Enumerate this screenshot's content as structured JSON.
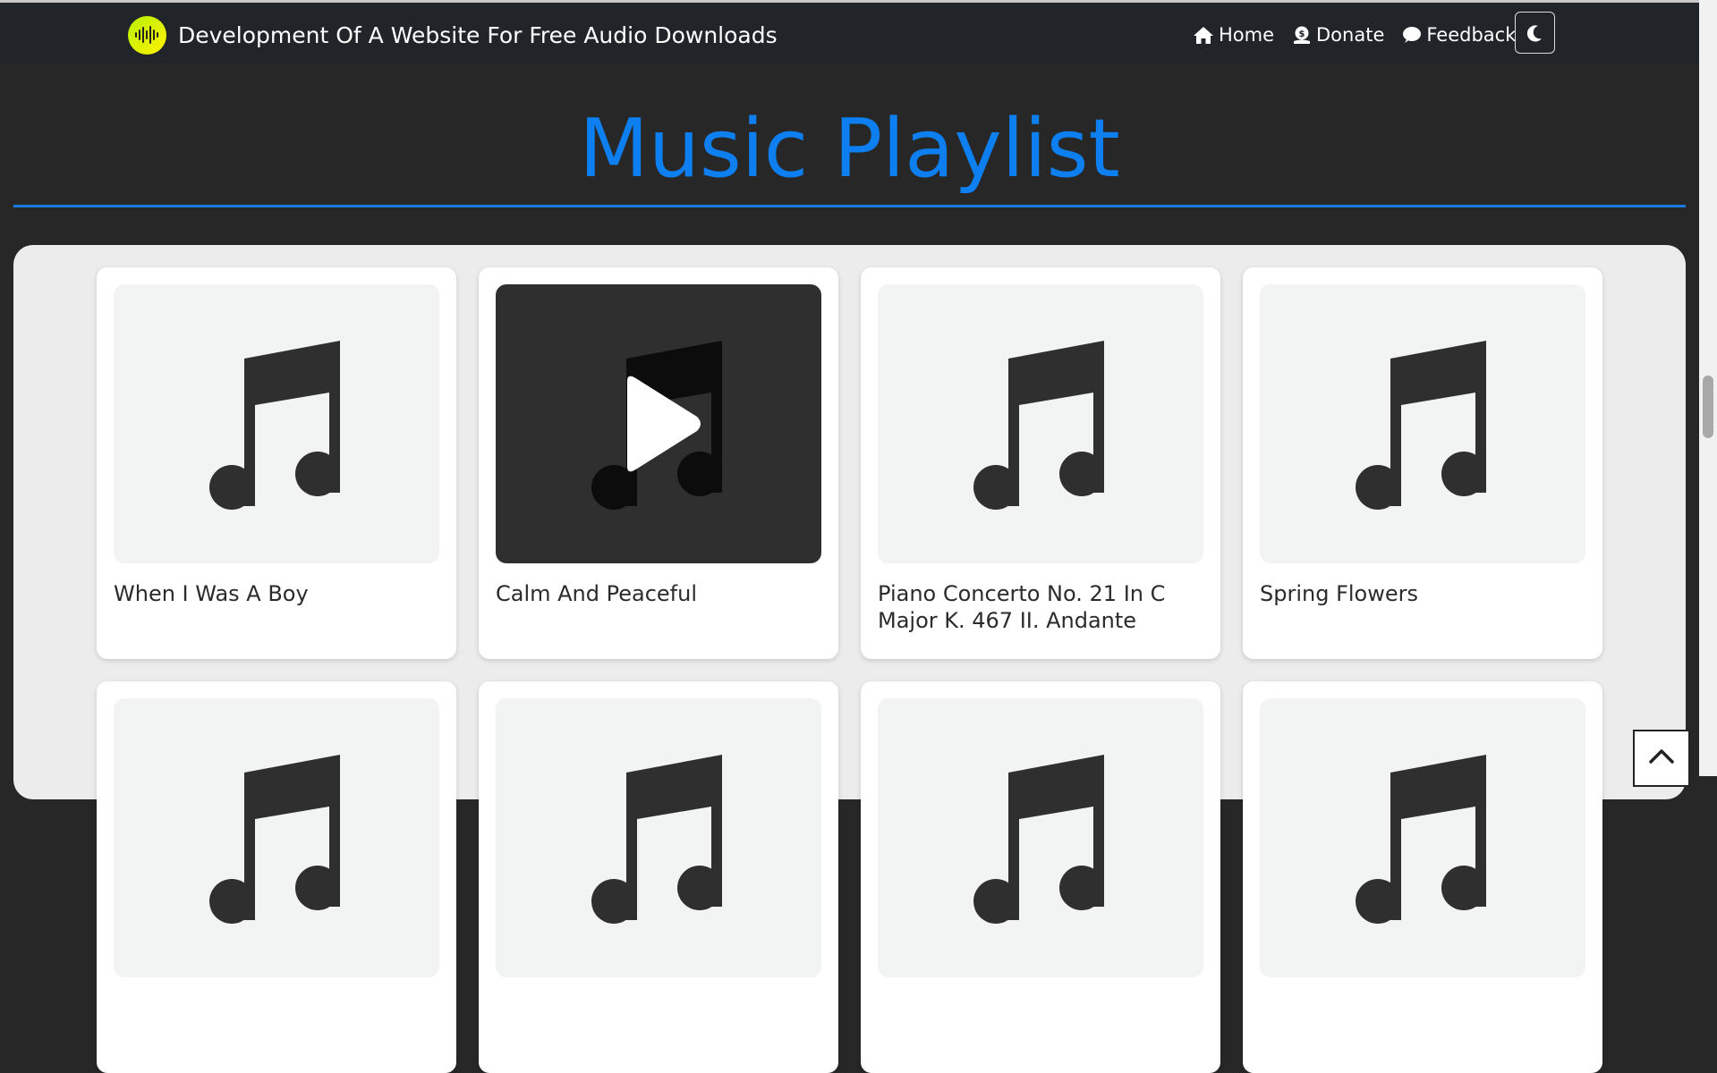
{
  "navbar": {
    "brand": "Development Of A Website For Free Audio Downloads",
    "links": [
      {
        "label": "Home",
        "icon": "home-icon"
      },
      {
        "label": "Donate",
        "icon": "donate-icon"
      },
      {
        "label": "Feedback",
        "icon": "feedback-icon"
      }
    ],
    "theme_toggle_icon": "moon-icon"
  },
  "page": {
    "title": "Music Playlist"
  },
  "tracks": [
    {
      "title": "When I Was A Boy",
      "icon": "music-note-icon",
      "hover": false
    },
    {
      "title": "Calm And Peaceful",
      "icon": "music-note-icon",
      "hover": true
    },
    {
      "title": "Piano Concerto No. 21 In C Major K. 467 II. Andante",
      "icon": "music-note-icon",
      "hover": false
    },
    {
      "title": "Spring Flowers",
      "icon": "music-note-icon",
      "hover": false
    }
  ],
  "colors": {
    "accent": "#0d7ff0",
    "navbar": "#212529",
    "background": "#272727"
  }
}
